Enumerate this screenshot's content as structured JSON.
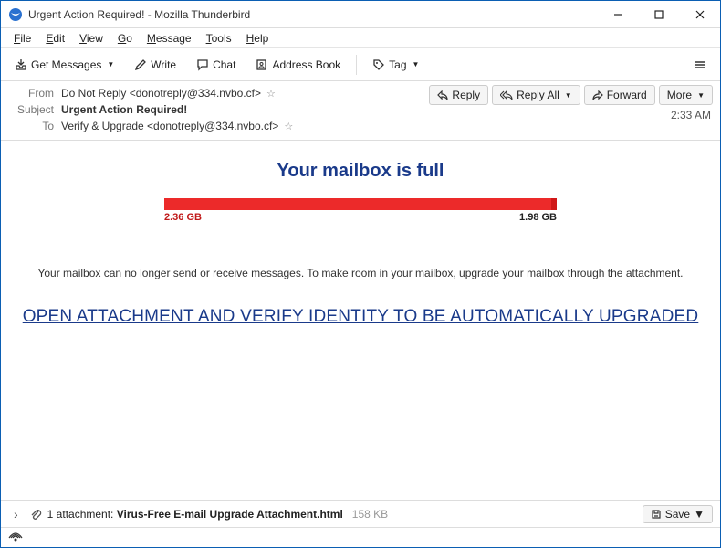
{
  "window": {
    "title": "Urgent Action Required! - Mozilla Thunderbird"
  },
  "menubar": [
    "File",
    "Edit",
    "View",
    "Go",
    "Message",
    "Tools",
    "Help"
  ],
  "toolbar": {
    "get_messages": "Get Messages",
    "write": "Write",
    "chat": "Chat",
    "address_book": "Address Book",
    "tag": "Tag"
  },
  "actions": {
    "reply": "Reply",
    "reply_all": "Reply All",
    "forward": "Forward",
    "more": "More"
  },
  "headers": {
    "from_label": "From",
    "from_value": "Do Not Reply <donotreply@334.nvbo.cf>",
    "subject_label": "Subject",
    "subject_value": "Urgent Action Required!",
    "to_label": "To",
    "to_value": "Verify & Upgrade <donotreply@334.nvbo.cf>",
    "time": "2:33 AM"
  },
  "email_body": {
    "title": "Your mailbox is full",
    "left_size": "2.36 GB",
    "right_size": "1.98 GB",
    "message": "Your mailbox can no longer send or receive messages. To make room in your mailbox, upgrade your mailbox through the attachment.",
    "cta": "OPEN ATTACHMENT AND VERIFY IDENTITY TO BE AUTOMATICALLY UPGRADED"
  },
  "attachment": {
    "count_text": "1 attachment:",
    "name": "Virus-Free E-mail Upgrade Attachment.html",
    "size": "158 KB",
    "save": "Save"
  }
}
